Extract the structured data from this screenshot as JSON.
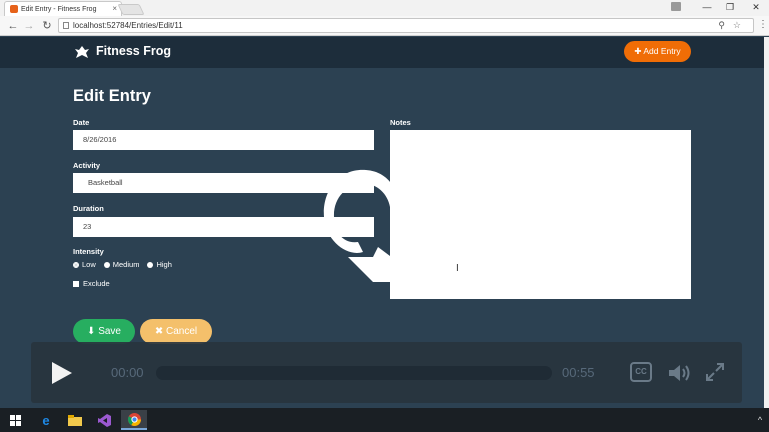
{
  "browser": {
    "tab_title": "Edit Entry - Fitness Frog",
    "tab_close": "×",
    "url": "localhost:52784/Entries/Edit/11",
    "window_min": "—",
    "window_max": "❐",
    "window_close": "✕"
  },
  "header": {
    "brand": "Fitness Frog",
    "add_entry_label": "Add Entry"
  },
  "form": {
    "title": "Edit Entry",
    "date_label": "Date",
    "date_value": "8/26/2016",
    "activity_label": "Activity",
    "activity_value": "Basketball",
    "duration_label": "Duration",
    "duration_value": "23",
    "notes_label": "Notes",
    "intensity_label": "Intensity",
    "intensity_options": [
      "Low",
      "Medium",
      "High"
    ],
    "intensity_selected": "Low",
    "exclude_label": "Exclude",
    "save_label": "Save",
    "cancel_label": "Cancel"
  },
  "player": {
    "current_time": "00:00",
    "duration": "00:55",
    "progress": 0,
    "cc_label": "CC"
  },
  "colors": {
    "page_bg": "#2c4152",
    "header_bg": "#1d2d3b",
    "add_entry": "#f06d06",
    "save": "#27ae60",
    "cancel": "#f4c06b"
  },
  "taskbar": {
    "items": [
      "windows-start-icon",
      "edge-icon",
      "file-explorer-icon",
      "visual-studio-icon",
      "chrome-icon"
    ]
  }
}
